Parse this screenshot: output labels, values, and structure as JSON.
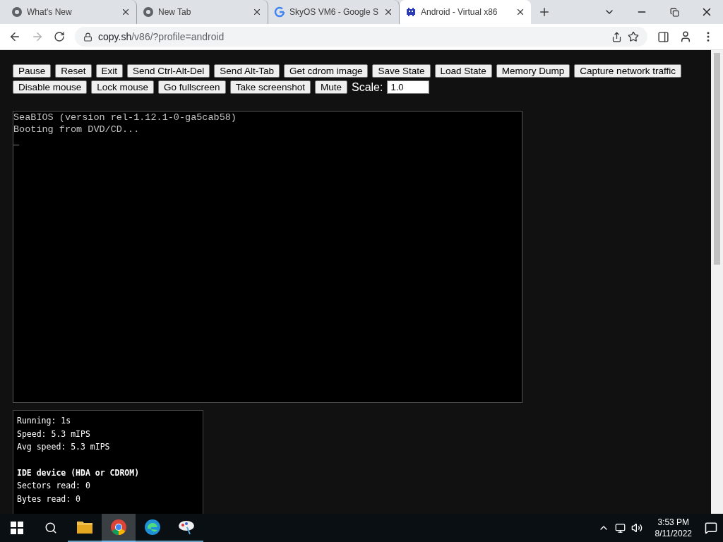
{
  "tabs": [
    {
      "title": "What's New",
      "selected": false
    },
    {
      "title": "New Tab",
      "selected": false
    },
    {
      "title": "SkyOS VM6 - Google S",
      "selected": false
    },
    {
      "title": "Android - Virtual x86",
      "selected": true
    }
  ],
  "address": {
    "host": "copy.sh",
    "path": "/v86/?profile=android"
  },
  "controls": {
    "top_buttons": [
      "Pause",
      "Reset",
      "Exit",
      "Send Ctrl-Alt-Del",
      "Send Alt-Tab",
      "Get cdrom image",
      "Save State",
      "Load State",
      "Memory Dump",
      "Capture network traffic"
    ],
    "bottom_buttons": [
      "Disable mouse",
      "Lock mouse",
      "Go fullscreen",
      "Take screenshot",
      "Mute"
    ],
    "scale_label": "Scale:",
    "scale_value": "1.0"
  },
  "screen": {
    "lines": [
      "SeaBIOS (version rel-1.12.1-0-ga5cab58)",
      "Booting from DVD/CD...",
      "_"
    ]
  },
  "stats": [
    {
      "kind": "line",
      "text": "Running: 1s"
    },
    {
      "kind": "line",
      "text": "Speed: 5.3 mIPS"
    },
    {
      "kind": "line",
      "text": "Avg speed: 5.3 mIPS"
    },
    {
      "kind": "heading",
      "text": "IDE device (HDA or CDROM)"
    },
    {
      "kind": "line",
      "text": "Sectors read: 0"
    },
    {
      "kind": "line",
      "text": "Bytes read: 0"
    }
  ],
  "taskbar": {
    "apps": [
      {
        "kind": "folder",
        "active": false
      },
      {
        "kind": "chrome",
        "active": true
      },
      {
        "kind": "edge",
        "active": false
      },
      {
        "kind": "paint",
        "active": false
      }
    ],
    "time": "3:53 PM",
    "date": "8/11/2022"
  }
}
